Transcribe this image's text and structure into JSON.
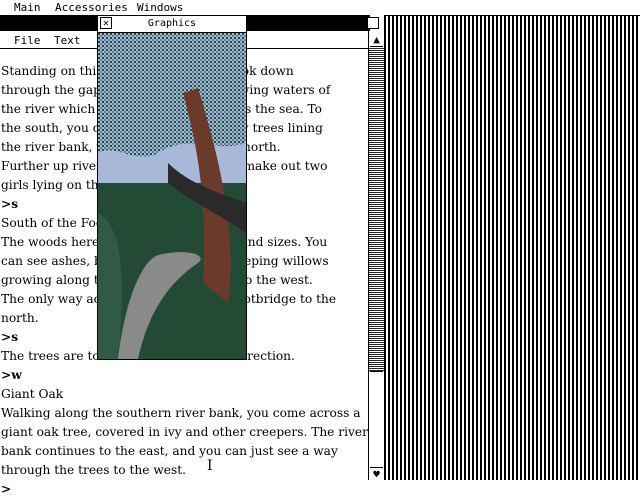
{
  "menubar": {
    "items": [
      "Main",
      "Accessories",
      "Windows"
    ]
  },
  "text_window": {
    "menu": [
      "File",
      "Text"
    ],
    "lines": [
      "Standing on this                              n look down",
      "through the gaps                              flowing waters of",
      "the river which r                             yards the sea. To",
      "the south, you ca                             illow trees lining",
      "the river bank, w                             the north.",
      "Further up river,                             just make out two",
      "girls lying on the",
      ">s",
      "South of the Foot",
      "The woods here                                es and sizes. You",
      "can see ashes, b                              f weeping willows",
      "growing along th                              es to the west.",
      "The only way ac                               a footbridge to the",
      "north.",
      ">s",
      "The trees are too                             at direction.",
      ">w",
      "Giant Oak",
      "Walking along the southern river bank, you come across a",
      "giant oak tree, covered in ivy and other creepers. The river",
      "bank continues to the east, and you can just see a way",
      "through the trees to the west.",
      ">"
    ]
  },
  "graphics_window": {
    "title": "Graphics",
    "close_glyph": "✕"
  },
  "scrollbar": {
    "up_glyph": "▲",
    "down_glyph": "♥"
  },
  "cursor_glyph": "I",
  "colors": {
    "sky": "#a8b8d8",
    "leaves": "#2e6f6a",
    "trunk": "#6b3a2a",
    "path": "#8a8a8a"
  }
}
